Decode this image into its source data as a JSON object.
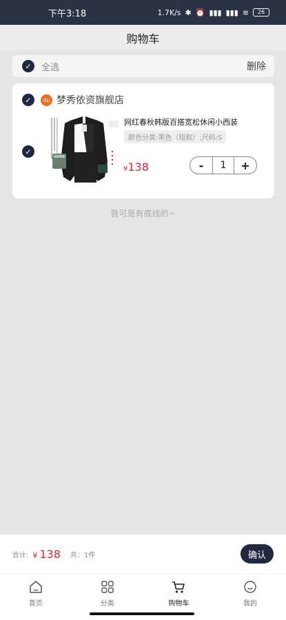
{
  "status_bar": {
    "time": "下午3:18",
    "speed": "1.7K/s",
    "battery": "26"
  },
  "nav": {
    "title": "购物车"
  },
  "select_all": {
    "label": "全选",
    "delete_label": "删除"
  },
  "shop": {
    "name": "梦秀依资旗舰店",
    "logo_text": "du"
  },
  "product": {
    "title": "网红春秋韩版百搭宽松休闲小西装",
    "spec": "颜色分类:黑色（短款）;尺码:S",
    "currency": "¥",
    "price": "138",
    "quantity": "1",
    "minus": "-",
    "plus": "+",
    "image_text": "设计有格调"
  },
  "bottom_line": "我可是有底线的~",
  "checkout": {
    "total_label": "合计:",
    "currency": "¥",
    "total": "138",
    "count_label": "共：1件",
    "confirm_label": "确认"
  },
  "tabs": [
    {
      "label": "首页",
      "icon": "home-icon"
    },
    {
      "label": "分类",
      "icon": "grid-icon"
    },
    {
      "label": "购物车",
      "icon": "cart-icon"
    },
    {
      "label": "我的",
      "icon": "user-icon"
    }
  ],
  "colors": {
    "accent": "#1f2940",
    "price": "#e0262c",
    "shop_logo": "#f36b1c"
  }
}
